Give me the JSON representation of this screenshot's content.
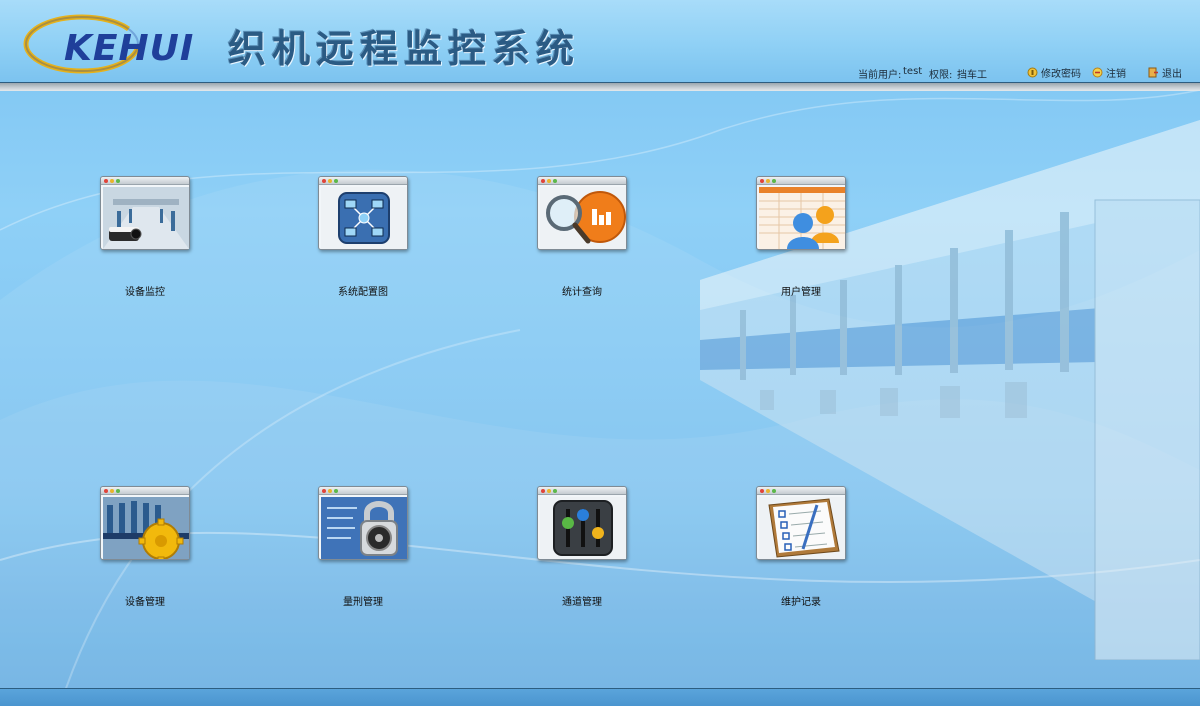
{
  "header": {
    "logo_text": "KEHUI",
    "title": "织机远程监控系统",
    "current_user_label": "当前用户:",
    "current_user": "test",
    "permission_label": "权限:",
    "permission": "挡车工",
    "change_password": "修改密码",
    "logout": "注销",
    "exit": "退出"
  },
  "tiles": [
    {
      "label": "设备监控",
      "icon": "camera-factory-icon"
    },
    {
      "label": "系统配置图",
      "icon": "network-diagram-icon"
    },
    {
      "label": "统计查询",
      "icon": "magnifier-chart-icon"
    },
    {
      "label": "用户管理",
      "icon": "users-table-icon"
    },
    {
      "label": "设备管理",
      "icon": "gear-factory-icon"
    },
    {
      "label": "量刑管理",
      "icon": "padlock-icon"
    },
    {
      "label": "通道管理",
      "icon": "control-knobs-icon"
    },
    {
      "label": "维护记录",
      "icon": "checklist-icon"
    }
  ],
  "colors": {
    "background": "#7cc4f2",
    "header_border": "#2c5d80",
    "title": "#2b5b84",
    "logo": "#1f3f9a",
    "logo_ring": "#e7b21a"
  }
}
